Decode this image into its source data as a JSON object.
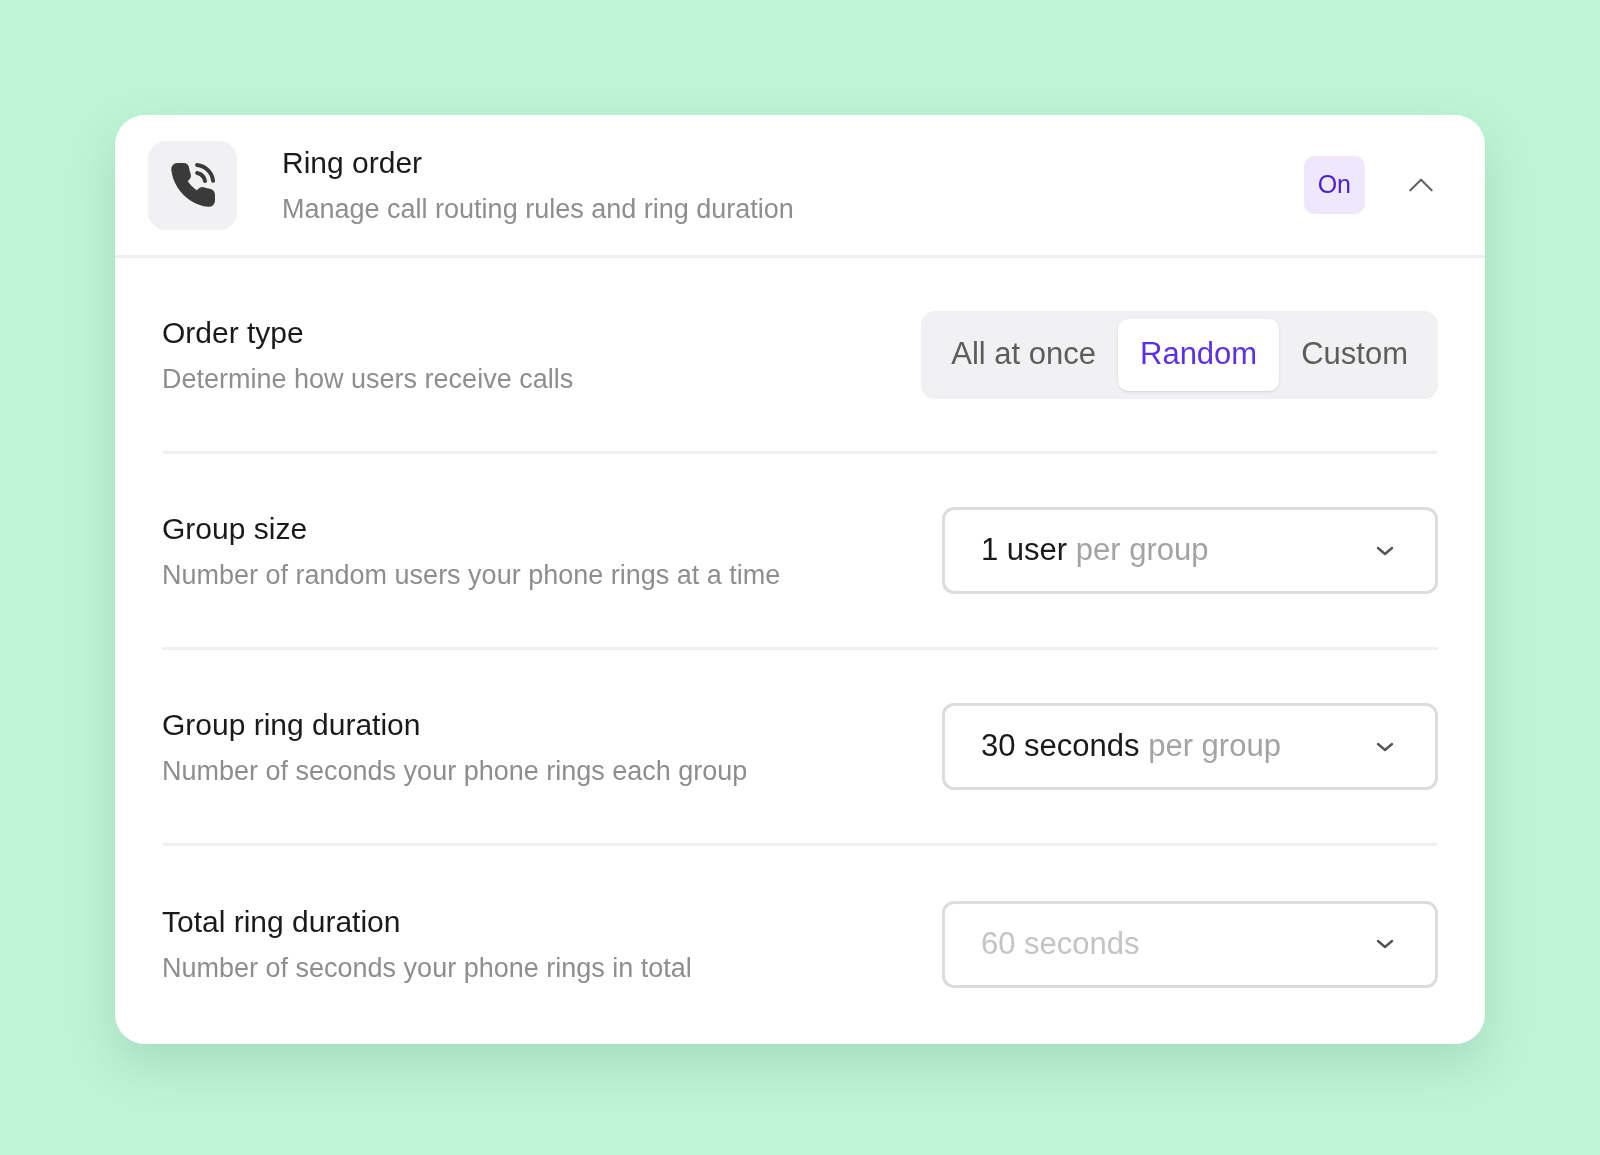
{
  "header": {
    "title": "Ring order",
    "subtitle": "Manage call routing rules and ring duration",
    "badge": "On",
    "expanded": true
  },
  "settings": [
    {
      "kind": "segmented",
      "title": "Order type",
      "description": "Determine how users receive calls",
      "options": [
        {
          "label": "All at once",
          "selected": false
        },
        {
          "label": "Random",
          "selected": true
        },
        {
          "label": "Custom",
          "selected": false
        }
      ]
    },
    {
      "kind": "dropdown",
      "title": "Group size",
      "description": "Number of random users your phone rings at a time",
      "value": "1 user",
      "suffix": "per group",
      "disabled": false
    },
    {
      "kind": "dropdown",
      "title": "Group ring duration",
      "description": "Number of seconds your phone rings each group",
      "value": "30 seconds",
      "suffix": "per group",
      "disabled": false
    },
    {
      "kind": "dropdown",
      "title": "Total ring duration",
      "description": "Number of seconds your phone rings in total",
      "value": "60 seconds",
      "disabled": true
    }
  ]
}
